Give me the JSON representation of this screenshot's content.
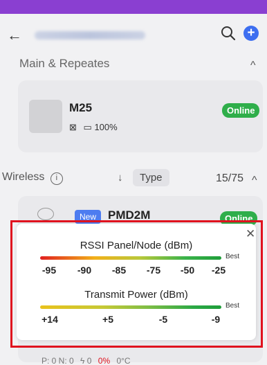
{
  "app": {
    "back_icon": "arrow-left-icon",
    "search_icon": "search-icon",
    "add_icon": "plus-icon",
    "accent": "#3d6ef0",
    "status_bar_color": "#8a3fd1"
  },
  "sections": {
    "main_title": "Main & Repeates",
    "wireless_title": "Wireless",
    "wireless_count": "15/75",
    "type_filter": "Type"
  },
  "main_device": {
    "name": "M25",
    "status": "Online",
    "battery": "100%"
  },
  "wireless_device": {
    "badge": "New",
    "name": "PMD2M",
    "status": "Online",
    "meta": "P: 0 N: 0",
    "lightning": "0",
    "percent": "0%",
    "temp": "0°C"
  },
  "legend_popup": {
    "rssi_title": "RSSI Panel/Node (dBm)",
    "rssi_best": "Best",
    "rssi_ticks": [
      "-95",
      "-90",
      "-85",
      "-75",
      "-50",
      "-25"
    ],
    "tx_title": "Transmit Power (dBm)",
    "tx_best": "Best",
    "tx_ticks": [
      "+14",
      "+5",
      "-5",
      "-9"
    ],
    "close_icon": "close-icon",
    "highlight_color": "#e0121e"
  }
}
